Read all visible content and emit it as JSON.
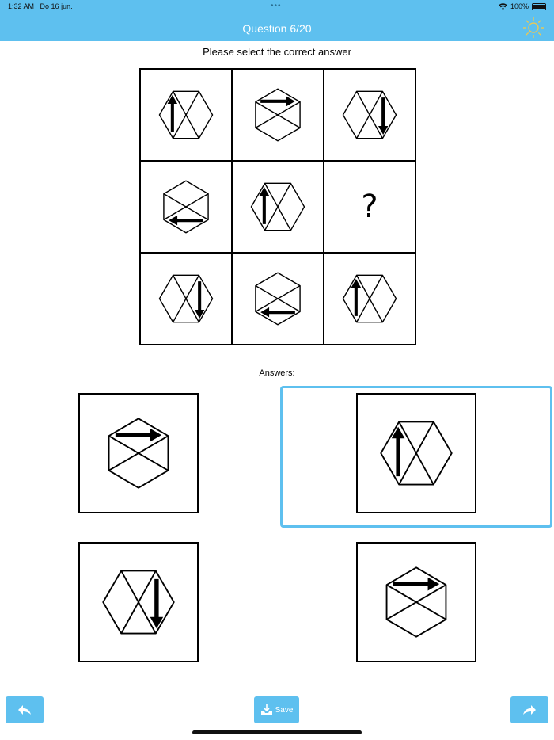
{
  "status_bar": {
    "time": "1:32 AM",
    "date": "Do 16 jun.",
    "battery": "100%"
  },
  "header": {
    "title": "Question 6/20"
  },
  "instruction": "Please select the correct answer",
  "grid": {
    "cells": [
      {
        "type": "hex",
        "orientation": "flat",
        "arrow": "up"
      },
      {
        "type": "hex",
        "orientation": "pointy",
        "arrow": "right"
      },
      {
        "type": "hex",
        "orientation": "flat",
        "arrow": "down"
      },
      {
        "type": "hex",
        "orientation": "pointy",
        "arrow": "left"
      },
      {
        "type": "hex",
        "orientation": "flat",
        "arrow": "up"
      },
      {
        "type": "missing",
        "text": "?"
      },
      {
        "type": "hex",
        "orientation": "flat",
        "arrow": "down"
      },
      {
        "type": "hex",
        "orientation": "pointy",
        "arrow": "left"
      },
      {
        "type": "hex",
        "orientation": "flat",
        "arrow": "up"
      }
    ]
  },
  "answers_label": "Answers:",
  "answers": [
    {
      "orientation": "pointy",
      "arrow": "right",
      "selected": false
    },
    {
      "orientation": "flat",
      "arrow": "up",
      "selected": true
    },
    {
      "orientation": "flat",
      "arrow": "down",
      "selected": false
    },
    {
      "orientation": "pointy",
      "arrow": "right",
      "selected": false
    }
  ],
  "footer": {
    "back_icon": "back-arrow-icon",
    "save_label": "Save",
    "next_icon": "forward-arrow-icon"
  },
  "colors": {
    "accent": "#5ec0ef",
    "header_text": "#ffffff",
    "sun": "#f3c84b"
  }
}
